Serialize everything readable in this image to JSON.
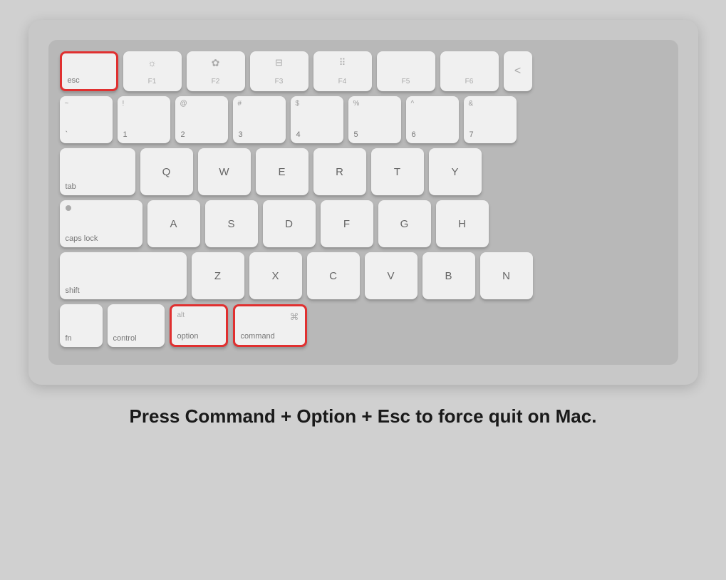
{
  "caption": "Press Command + Option + Esc to force quit on Mac.",
  "keyboard": {
    "rows": [
      {
        "id": "function-row",
        "keys": [
          {
            "id": "esc",
            "label": "esc",
            "top": "",
            "icon": "",
            "highlighted": true,
            "size": "esc-key"
          },
          {
            "id": "f1",
            "label": "F1",
            "top": "☼",
            "icon": "",
            "highlighted": false,
            "size": "fn-key-sm"
          },
          {
            "id": "f2",
            "label": "F2",
            "top": "☼",
            "icon": "",
            "highlighted": false,
            "size": "fn-key-sm"
          },
          {
            "id": "f3",
            "label": "F3",
            "top": "⊞",
            "icon": "",
            "highlighted": false,
            "size": "fn-key-sm"
          },
          {
            "id": "f4",
            "label": "F4",
            "top": "⠿",
            "icon": "",
            "highlighted": false,
            "size": "fn-key-sm"
          },
          {
            "id": "f5",
            "label": "F5",
            "top": "",
            "icon": "",
            "highlighted": false,
            "size": "fn-key-sm"
          },
          {
            "id": "f6",
            "label": "F6",
            "top": "",
            "icon": "",
            "highlighted": false,
            "size": "fn-key-sm"
          },
          {
            "id": "more",
            "label": "<",
            "top": "",
            "icon": "",
            "highlighted": false,
            "size": "overflow"
          }
        ]
      },
      {
        "id": "number-row",
        "keys": [
          {
            "id": "tilde",
            "label": "`",
            "top": "~",
            "highlighted": false,
            "size": "num-key"
          },
          {
            "id": "1",
            "label": "1",
            "top": "!",
            "highlighted": false,
            "size": "num-key"
          },
          {
            "id": "2",
            "label": "2",
            "top": "@",
            "highlighted": false,
            "size": "num-key"
          },
          {
            "id": "3",
            "label": "3",
            "top": "#",
            "highlighted": false,
            "size": "num-key"
          },
          {
            "id": "4",
            "label": "4",
            "top": "$",
            "highlighted": false,
            "size": "num-key"
          },
          {
            "id": "5",
            "label": "5",
            "top": "%",
            "highlighted": false,
            "size": "num-key"
          },
          {
            "id": "6",
            "label": "6",
            "top": "^",
            "highlighted": false,
            "size": "num-key"
          },
          {
            "id": "7",
            "label": "7",
            "top": "&",
            "highlighted": false,
            "size": "num-key"
          }
        ]
      },
      {
        "id": "qwerty-row",
        "keys": [
          {
            "id": "tab",
            "label": "tab",
            "top": "",
            "highlighted": false,
            "size": "tab-key"
          },
          {
            "id": "q",
            "label": "Q",
            "top": "",
            "highlighted": false,
            "size": "letter-key"
          },
          {
            "id": "w",
            "label": "W",
            "top": "",
            "highlighted": false,
            "size": "letter-key"
          },
          {
            "id": "e",
            "label": "E",
            "top": "",
            "highlighted": false,
            "size": "letter-key"
          },
          {
            "id": "r",
            "label": "R",
            "top": "",
            "highlighted": false,
            "size": "letter-key"
          },
          {
            "id": "t",
            "label": "T",
            "top": "",
            "highlighted": false,
            "size": "letter-key"
          },
          {
            "id": "y",
            "label": "Y",
            "top": "",
            "highlighted": false,
            "size": "letter-key"
          }
        ]
      },
      {
        "id": "asdf-row",
        "keys": [
          {
            "id": "caps",
            "label": "caps lock",
            "top": "•",
            "highlighted": false,
            "size": "caps-key"
          },
          {
            "id": "a",
            "label": "A",
            "top": "",
            "highlighted": false,
            "size": "letter-key"
          },
          {
            "id": "s",
            "label": "S",
            "top": "",
            "highlighted": false,
            "size": "letter-key"
          },
          {
            "id": "d",
            "label": "D",
            "top": "",
            "highlighted": false,
            "size": "letter-key"
          },
          {
            "id": "f",
            "label": "F",
            "top": "",
            "highlighted": false,
            "size": "letter-key"
          },
          {
            "id": "g",
            "label": "G",
            "top": "",
            "highlighted": false,
            "size": "letter-key"
          },
          {
            "id": "h",
            "label": "H",
            "top": "",
            "highlighted": false,
            "size": "letter-key"
          }
        ]
      },
      {
        "id": "zxcv-row",
        "keys": [
          {
            "id": "shift",
            "label": "shift",
            "top": "",
            "highlighted": false,
            "size": "shift-key"
          },
          {
            "id": "z",
            "label": "Z",
            "top": "",
            "highlighted": false,
            "size": "letter-key"
          },
          {
            "id": "x",
            "label": "X",
            "top": "",
            "highlighted": false,
            "size": "letter-key"
          },
          {
            "id": "c",
            "label": "C",
            "top": "",
            "highlighted": false,
            "size": "letter-key"
          },
          {
            "id": "v",
            "label": "V",
            "top": "",
            "highlighted": false,
            "size": "letter-key"
          },
          {
            "id": "b",
            "label": "B",
            "top": "",
            "highlighted": false,
            "size": "letter-key"
          },
          {
            "id": "n",
            "label": "N",
            "top": "",
            "highlighted": false,
            "size": "letter-key"
          }
        ]
      },
      {
        "id": "bottom-row",
        "keys": [
          {
            "id": "fn",
            "label": "fn",
            "top": "",
            "highlighted": false,
            "size": "fn-bottom"
          },
          {
            "id": "control",
            "label": "control",
            "top": "",
            "highlighted": false,
            "size": "ctrl-bottom"
          },
          {
            "id": "option",
            "label": "option",
            "top": "alt",
            "highlighted": true,
            "size": "option-bottom"
          },
          {
            "id": "command",
            "label": "command",
            "top": "⌘",
            "highlighted": true,
            "size": "command-bottom"
          }
        ]
      }
    ]
  },
  "colors": {
    "highlight_border": "#e03030",
    "key_bg": "#f0f0f0",
    "key_shadow": "#999",
    "keyboard_bg": "#c8c8c8",
    "caption_color": "#1a1a1a",
    "page_bg": "#d0d0d0"
  }
}
